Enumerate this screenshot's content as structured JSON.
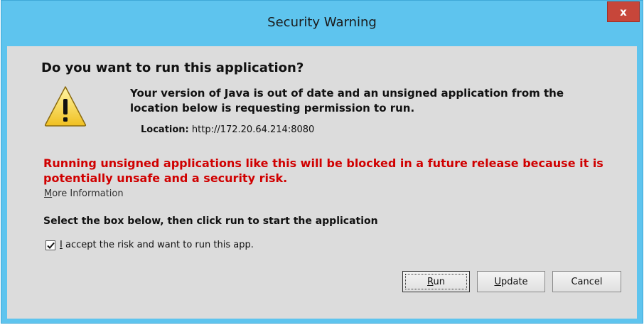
{
  "window": {
    "title": "Security Warning",
    "close_label": "x"
  },
  "dialog": {
    "heading": "Do you want to run this application?",
    "message": "Your version of Java is out of date and an unsigned application from the location below is requesting permission to run.",
    "location_label": "Location:",
    "location_value": "http://172.20.64.214:8080",
    "warning_text": "Running unsigned applications like this will be blocked in a future release because it is potentially unsafe and a security risk.",
    "more_info_link": "More Information",
    "instruction": "Select the box below, then click run to start the application",
    "accept_checkbox": {
      "label": "I accept the risk and want to run this app.",
      "checked": true
    },
    "buttons": {
      "run": "Run",
      "update": "Update",
      "cancel": "Cancel"
    }
  },
  "icons": {
    "warning": "warning-triangle-icon",
    "checkmark": "checkmark-icon"
  },
  "colors": {
    "titlebar": "#5ec4ee",
    "close_button": "#c7463a",
    "client_background": "#dcdcdc",
    "warning_text": "#d00000"
  }
}
